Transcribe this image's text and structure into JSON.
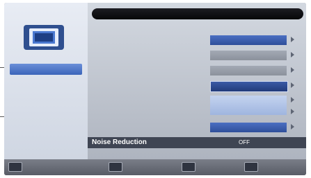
{
  "title_bar": {
    "text": ""
  },
  "sidebar": {
    "icon": "picture-settings-icon",
    "items": [
      {
        "label": "",
        "active": true
      },
      {
        "label": "",
        "active": false
      },
      {
        "label": "",
        "active": false
      },
      {
        "label": "",
        "active": false
      },
      {
        "label": "",
        "active": false
      },
      {
        "label": "",
        "active": false
      },
      {
        "label": "",
        "active": false
      }
    ]
  },
  "settings": {
    "rows": [
      {
        "label": "",
        "value": ""
      },
      {
        "label": "",
        "value": ""
      },
      {
        "label": "",
        "value": ""
      },
      {
        "label": "",
        "value": ""
      },
      {
        "label": "",
        "value": ""
      },
      {
        "label": "",
        "value": ""
      },
      {
        "label": "",
        "value": ""
      },
      {
        "label": "Noise Reduction",
        "value": "OFF"
      }
    ]
  },
  "footer": {
    "buttons": [
      {
        "label": ""
      },
      {
        "label": ""
      },
      {
        "label": ""
      },
      {
        "label": ""
      }
    ]
  }
}
